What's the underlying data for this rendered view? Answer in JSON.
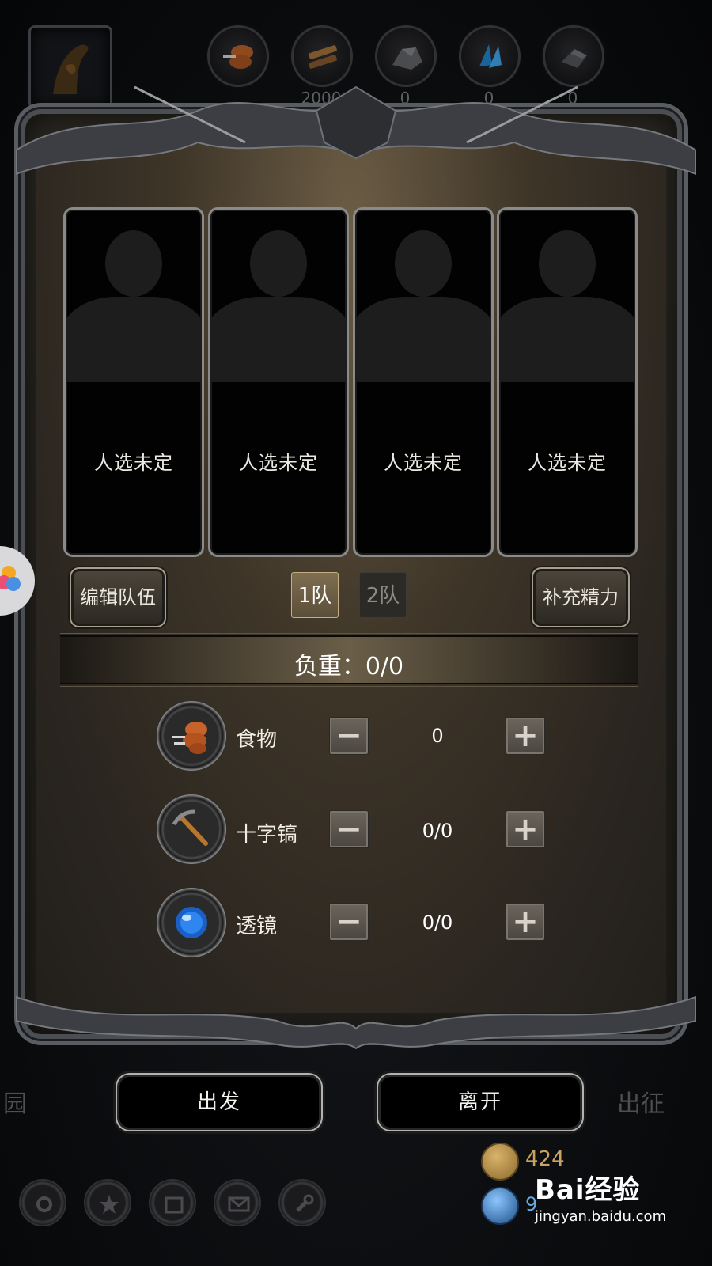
{
  "resources": [
    {
      "name": "food",
      "icon": "food-icon",
      "count": ""
    },
    {
      "name": "wood",
      "icon": "wood-icon",
      "count": "2000"
    },
    {
      "name": "stone",
      "icon": "stone-icon",
      "count": "0"
    },
    {
      "name": "crystal",
      "icon": "crystal-icon",
      "count": "0"
    },
    {
      "name": "iron",
      "icon": "iron-icon",
      "count": "0"
    }
  ],
  "slots": [
    {
      "label": "人选未定"
    },
    {
      "label": "人选未定"
    },
    {
      "label": "人选未定"
    },
    {
      "label": "人选未定"
    }
  ],
  "controls": {
    "edit_team": "编辑队伍",
    "team1": "1队",
    "team2": "2队",
    "refill_energy": "补充精力",
    "active_team": "1队"
  },
  "load": {
    "label": "负重：0/0"
  },
  "supplies": [
    {
      "name": "食物",
      "icon": "drumstick-icon",
      "quantity": "0"
    },
    {
      "name": "十字镐",
      "icon": "pickaxe-icon",
      "quantity": "0/0"
    },
    {
      "name": "透镜",
      "icon": "lens-icon",
      "quantity": "0/0"
    }
  ],
  "stepper": {
    "minus": "−",
    "plus": "+"
  },
  "actions": {
    "depart": "出发",
    "leave": "离开"
  },
  "side_labels": {
    "left": "园",
    "right": "出征"
  },
  "currency": {
    "gold": "424",
    "gems": "9"
  },
  "watermark": {
    "main": "Bai经验",
    "sub": "jingyan.baidu.com"
  },
  "colors": {
    "accent_gold": "#c9a361",
    "panel": "#2b2620",
    "slot_border": "#8a8a88"
  }
}
